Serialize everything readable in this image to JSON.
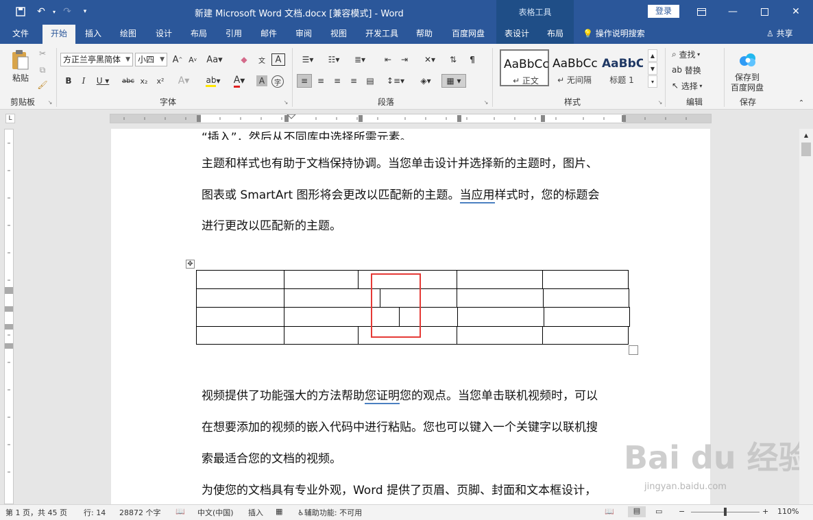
{
  "title_bar": {
    "doc_title": "新建 Microsoft Word 文档.docx [兼容模式]  -  Word",
    "context_header": "表格工具",
    "login_label": "登录"
  },
  "tabs": [
    {
      "label": "文件"
    },
    {
      "label": "开始",
      "active": true
    },
    {
      "label": "插入"
    },
    {
      "label": "绘图"
    },
    {
      "label": "设计"
    },
    {
      "label": "布局"
    },
    {
      "label": "引用"
    },
    {
      "label": "邮件"
    },
    {
      "label": "审阅"
    },
    {
      "label": "视图"
    },
    {
      "label": "开发工具"
    },
    {
      "label": "帮助"
    },
    {
      "label": "百度网盘"
    },
    {
      "label": "表设计"
    },
    {
      "label": "布局"
    }
  ],
  "tell_me": "操作说明搜索",
  "share_label": "共享",
  "ribbon": {
    "clipboard": {
      "paste_label": "粘贴",
      "group_label": "剪贴板"
    },
    "font": {
      "font_name": "方正兰亭黑简体",
      "font_size": "小四",
      "group_label": "字体"
    },
    "paragraph": {
      "group_label": "段落"
    },
    "styles": {
      "items": [
        {
          "sample": "AaBbCc",
          "name": "↵ 正文"
        },
        {
          "sample": "AaBbCc",
          "name": "↵ 无间隔"
        },
        {
          "sample": "AaBbC",
          "name": "标题 1"
        }
      ],
      "group_label": "样式"
    },
    "editing": {
      "find": "查找",
      "replace": "替换",
      "select": "选择",
      "group_label": "编辑"
    },
    "save": {
      "label_line1": "保存到",
      "label_line2": "百度网盘",
      "group_label": "保存"
    }
  },
  "document": {
    "top_cut_line": "“插入”，然后从不同库中选择所需元素。",
    "para1": [
      "主题和样式也有助于文档保持协调。当您单击设计并选择新的主题时，图片、",
      "图表或 SmartArt 图形将会更改以匹配新的主题。",
      "当应用",
      "样式时，您的标题会",
      "进行更改以匹配新的主题。"
    ],
    "para2": [
      "视频提供了功能强大的方法帮助",
      "您证明",
      "您的观点。当您单击联机视频时，可以",
      "在想要添加的视频的嵌入代码中进行粘贴。您也可以键入一个关键字以联机搜",
      "索最适合您的文档的视频。"
    ],
    "para3": "为使您的文档具有专业外观，Word 提供了页眉、页脚、封面和文本框设计，"
  },
  "status_bar": {
    "page": "第 1 页，共 45 页",
    "line": "行: 14",
    "words": "28872 个字",
    "language": "中文(中国)",
    "insert_mode": "插入",
    "accessibility": "辅助功能: 不可用",
    "zoom": "110%"
  },
  "watermark": {
    "brand": "Bai du 经验",
    "url": "jingyan.baidu.com"
  },
  "colors": {
    "accent": "#2b579a",
    "highlight_box": "#e53935"
  }
}
